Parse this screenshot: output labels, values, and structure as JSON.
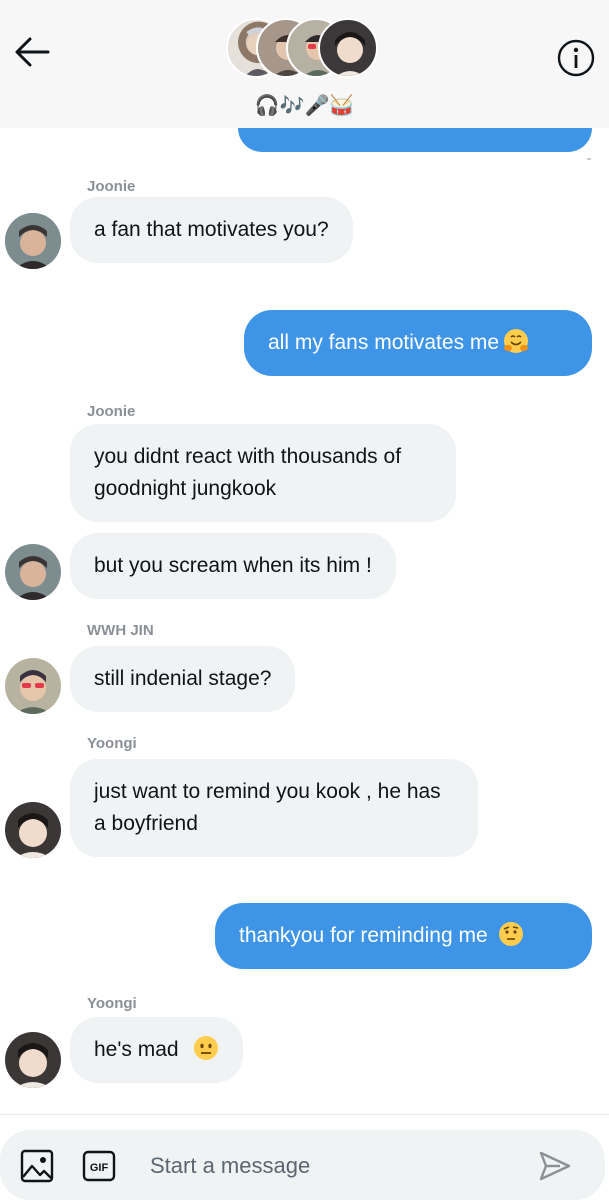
{
  "header": {
    "group_title": "🎧🎶🎤🥁",
    "icons": {
      "back": "arrow-left-icon",
      "info": "info-icon"
    }
  },
  "messages": [
    {
      "type": "incoming",
      "sender": "Joonie",
      "texts": [
        "a fan that motivates you?"
      ]
    },
    {
      "type": "outgoing",
      "text": "all my fans motivates me",
      "emoji": "hugging-face-emoji"
    },
    {
      "type": "incoming",
      "sender": "Joonie",
      "texts": [
        "you didnt react with thousands of goodnight jungkook",
        "but you scream when its him !"
      ]
    },
    {
      "type": "incoming",
      "sender": "WWH JIN",
      "texts": [
        "still indenial stage?"
      ]
    },
    {
      "type": "incoming",
      "sender": "Yoongi",
      "texts": [
        "just want to remind you kook , he has a boyfriend"
      ]
    },
    {
      "type": "outgoing",
      "text": "thankyou for reminding me",
      "emoji": "raised-eyebrow-emoji"
    },
    {
      "type": "incoming",
      "sender": "Yoongi",
      "texts": [
        "he's mad"
      ],
      "emoji": "neutral-face-emoji"
    }
  ],
  "composer": {
    "placeholder": "Start a message",
    "gif_label": "GIF",
    "icons": {
      "image": "image-icon",
      "gif": "gif-icon",
      "send": "send-icon"
    }
  },
  "colors": {
    "accent": "#3e95e8",
    "incoming_bubble": "#eff3f4",
    "header_bg": "#f7f7f7"
  }
}
